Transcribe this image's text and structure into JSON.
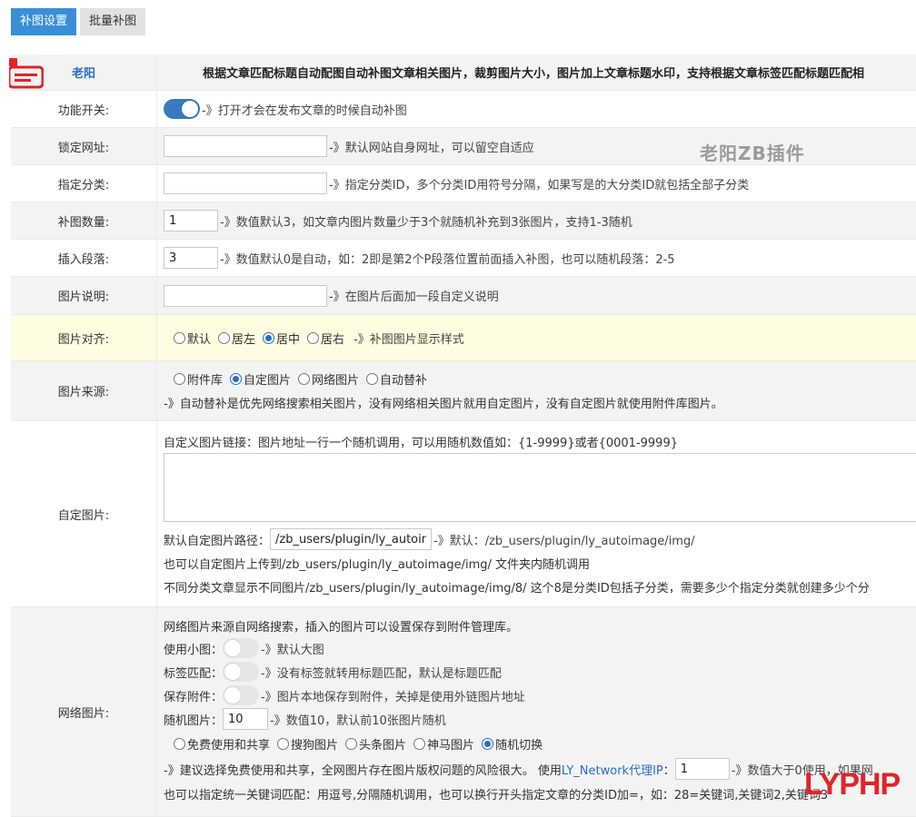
{
  "tabs": [
    {
      "label": "补图设置"
    },
    {
      "label": "批量补图"
    }
  ],
  "header": {
    "author": "老阳",
    "description": "根据文章匹配标题自动配图自动补图文章相关图片，裁剪图片大小，图片加上文章标题水印，支持根据文章标签匹配标题匹配相"
  },
  "watermark": "老阳ZB插件",
  "rows": {
    "enable": {
      "label": "功能开关:",
      "hint": "-》打开才会在发布文章的时候自动补图",
      "state": "on"
    },
    "lock_url": {
      "label": "锁定网址:",
      "value": "",
      "hint": "-》默认网站自身网址，可以留空自适应"
    },
    "category": {
      "label": "指定分类:",
      "value": "",
      "hint": "-》指定分类ID，多个分类ID用符号分隔，如果写是的大分类ID就包括全部子分类"
    },
    "count": {
      "label": "补图数量:",
      "value": "1",
      "hint": "-》数值默认3，如文章内图片数量少于3个就随机补充到3张图片，支持1-3随机"
    },
    "paragraph": {
      "label": "插入段落:",
      "value": "3",
      "hint": "-》数值默认0是自动，如：2即是第2个P段落位置前面插入补图，也可以随机段落：2-5"
    },
    "caption": {
      "label": "图片说明:",
      "value": "",
      "hint": "-》在图片后面加一段自定义说明"
    },
    "align": {
      "label": "图片对齐:",
      "options": [
        "默认",
        "居左",
        "居中",
        "居右"
      ],
      "selected": "居中",
      "hint": "-》补图图片显示样式"
    },
    "source": {
      "label": "图片来源:",
      "options": [
        "附件库",
        "自定图片",
        "网络图片",
        "自动替补"
      ],
      "selected": "自定图片",
      "hint": "-》自动替补是优先网络搜索相关图片，没有网络相关图片就用自定图片，没有自定图片就使用附件库图片。"
    },
    "custom": {
      "label": "自定图片:",
      "intro": "自定义图片链接：图片地址一行一个随机调用，可以用随机数值如：{1-9999}或者{0001-9999}",
      "textarea": "",
      "path_label": "默认自定图片路径：",
      "path_value": "/zb_users/plugin/ly_autoimage/img/",
      "path_hint": "-》默认：/zb_users/plugin/ly_autoimage/img/",
      "note1": "也可以自定图片上传到/zb_users/plugin/ly_autoimage/img/ 文件夹内随机调用",
      "note2": "不同分类文章显示不同图片/zb_users/plugin/ly_autoimage/img/8/ 这个8是分类ID包括子分类，需要多少个指定分类就创建多少个分"
    },
    "network": {
      "label": "网络图片:",
      "intro": "网络图片来源自网络搜索，插入的图片可以设置保存到附件管理库。",
      "small": {
        "label": "使用小图：",
        "hint": "-》默认大图",
        "state": "off"
      },
      "tag": {
        "label": "标签匹配：",
        "hint": "-》没有标签就转用标题匹配，默认是标题匹配",
        "state": "off"
      },
      "save": {
        "label": "保存附件：",
        "hint": "-》图片本地保存到附件，关掉是使用外链图片地址",
        "state": "off"
      },
      "random": {
        "label": "随机图片：",
        "value": "10",
        "hint": "-》数值10，默认前10张图片随机"
      },
      "options": [
        "免费使用和共享",
        "搜狗图片",
        "头条图片",
        "神马图片",
        "随机切换"
      ],
      "selected": "随机切换",
      "advice_pre": "-》建议选择免费使用和共享，全网图片存在图片版权问题的风险很大。 使用",
      "advice_link": "LY_Network代理IP",
      "advice_colon": "：",
      "proxy_value": "1",
      "proxy_hint": "-》数值大于0使用，如果网",
      "keyword_note": "也可以指定统一关键词匹配：用逗号,分隔随机调用，也可以换行开头指定文章的分类ID加=，如：28=关键词,关键词2,关键词3"
    }
  },
  "corner_logo": {
    "part1": "LY",
    "part2": "PHP"
  },
  "colors": {
    "accent": "#3a8ed6",
    "toggle_on": "#3a79c0",
    "brand_red": "#e0242a",
    "highlight_row": "#fefde1"
  }
}
